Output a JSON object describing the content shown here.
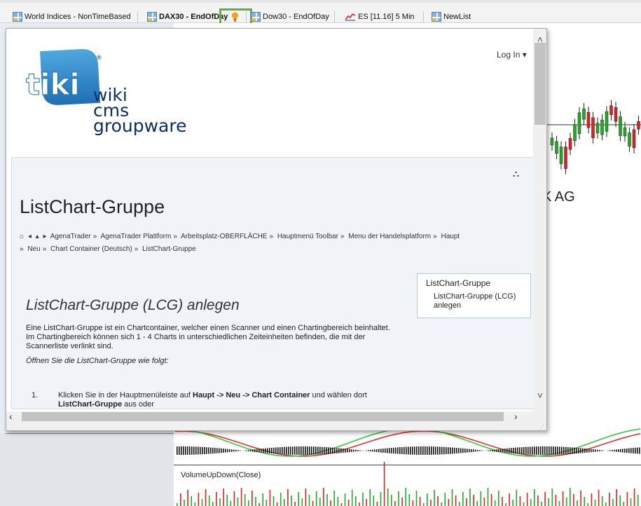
{
  "tabs": [
    {
      "label": "World Indices - NonTimeBased",
      "icon": "grid-icon",
      "active": false
    },
    {
      "label": "DAX30 - EndOfDay",
      "icon": "grid-icon",
      "active": true,
      "extra_icon": "lightbulb-icon"
    },
    {
      "label": "Dow30 - EndOfDay",
      "icon": "grid-icon",
      "active": false
    },
    {
      "label": "ES [11.16] 5 Min",
      "icon": "line-chart-icon",
      "active": false
    },
    {
      "label": "NewList",
      "icon": "grid-icon",
      "active": false
    }
  ],
  "highlight_color": "#6aa84f",
  "background_chart": {
    "ticker_partial": "K AG",
    "indicator_label": "VolumeUpDown(Close)",
    "colors": {
      "up": "#22aa22",
      "down": "#dd2222",
      "line_green": "#2ecc40",
      "line_red": "#e53030"
    }
  },
  "wiki": {
    "login_label": "Log In",
    "logo": {
      "brand": "tiki",
      "registered": "®",
      "tagline_lines": [
        "wiki",
        "cms",
        "groupware"
      ]
    },
    "page_title": "ListChart-Gruppe",
    "breadcrumb": {
      "items": [
        "AgenaTrader",
        "AgenaTrader Plattform",
        "Arbeitsplatz-OBERFLÄCHE",
        "Hauptmenü Toolbar",
        "Menu der Handelsplatform",
        "Haupt",
        "Neu",
        "Chart Container (Deutsch)",
        "ListChart-Gruppe"
      ],
      "separator": "»"
    },
    "toc": {
      "title": "ListChart-Gruppe",
      "items": [
        "ListChart-Gruppe (LCG) anlegen"
      ]
    },
    "section_heading": "ListChart-Gruppe (LCG) anlegen",
    "paragraphs": [
      "Eine ListChart-Gruppe ist ein Chartcontainer, welcher einen Scanner und einen Chartingbereich beinhaltet.",
      "Im Chartingbereich können sich 1 - 4 Charts in unterschiedlichen Zeiteinheiten befinden, die mit der Scannerliste verlinkt sind."
    ],
    "italic_line": "Öffnen Sie die ListChart-Gruppe wie folgt:",
    "step1": {
      "number": "1.",
      "prefix": "Klicken Sie in der Hauptmenüleiste auf ",
      "bold_path": "Haupt -> Neu -> Chart Container",
      "middle": " und wählen dort ",
      "bold_item": "ListChart-Gruppe",
      "suffix": " aus oder"
    }
  }
}
